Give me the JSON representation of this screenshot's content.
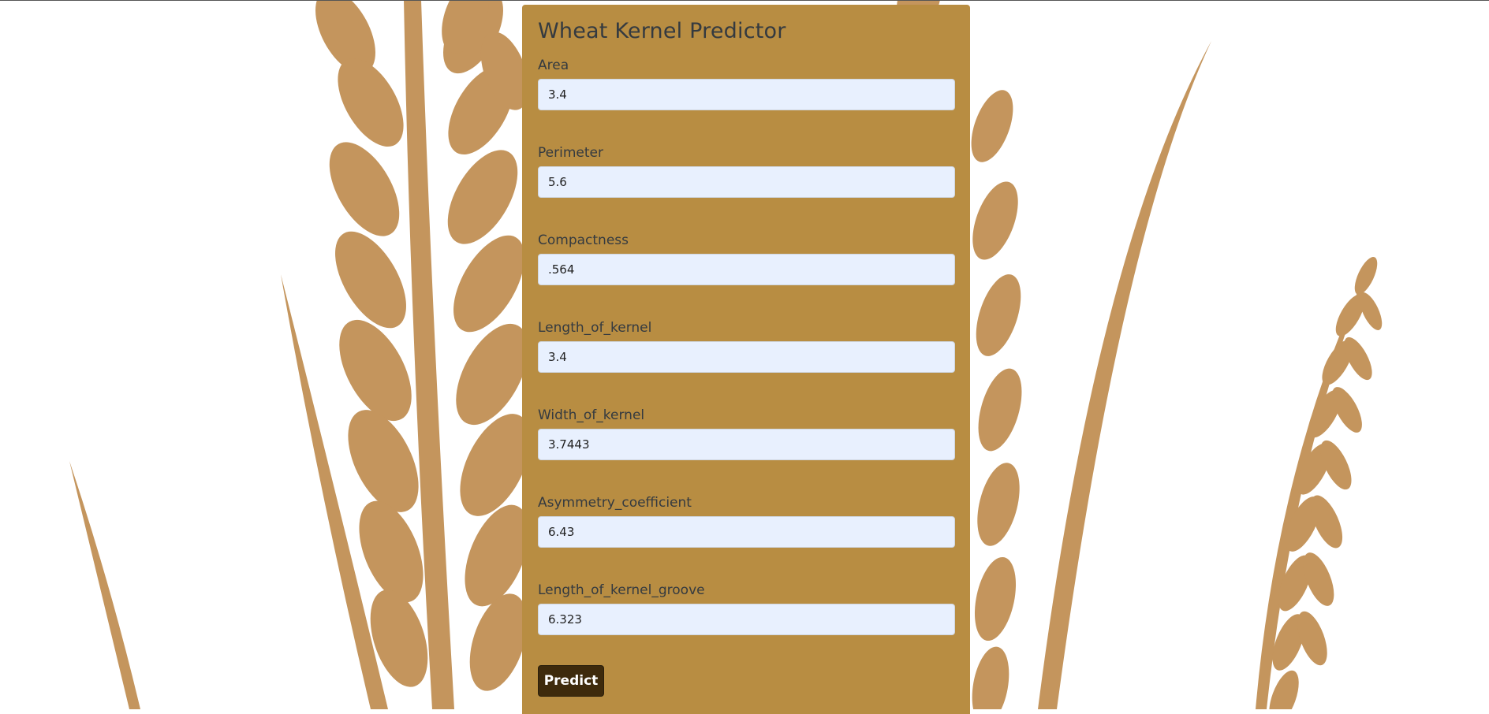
{
  "page": {
    "title": "Wheat Kernel Predictor",
    "background_image": "wheat-stalks-illustration",
    "colors": {
      "panel": "#b88d42",
      "wheat": "#c4955d",
      "input_background": "#e8f0fe",
      "button": "#3e2a0c",
      "text": "#343a40"
    }
  },
  "form": {
    "fields": [
      {
        "label": "Area",
        "value": "3.4"
      },
      {
        "label": "Perimeter",
        "value": "5.6"
      },
      {
        "label": "Compactness",
        "value": ".564"
      },
      {
        "label": "Length_of_kernel",
        "value": "3.4"
      },
      {
        "label": "Width_of_kernel",
        "value": "3.7443"
      },
      {
        "label": "Asymmetry_coefficient",
        "value": "6.43"
      },
      {
        "label": "Length_of_kernel_groove",
        "value": "6.323"
      }
    ],
    "submit_label": "Predict"
  }
}
